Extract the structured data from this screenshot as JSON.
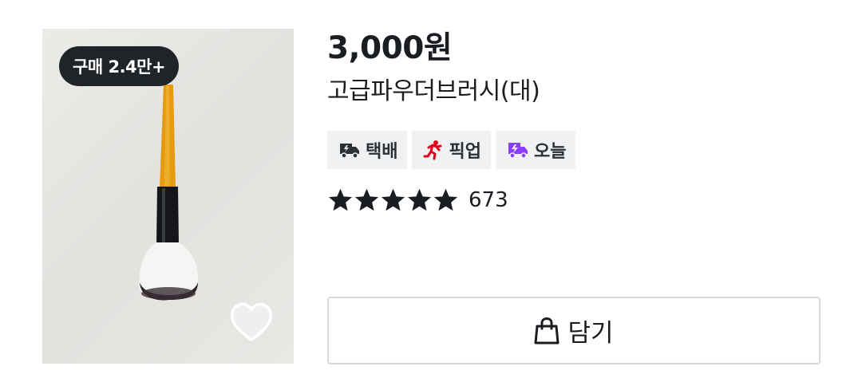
{
  "product": {
    "badge": "구매 2.4만+",
    "price": "3,000원",
    "name": "고급파우더브러시(대)",
    "tags": [
      {
        "label": "택배",
        "icon": "delivery-truck-icon",
        "icon_color": "#2c3137"
      },
      {
        "label": "픽업",
        "icon": "running-person-icon",
        "icon_color": "#e0001b"
      },
      {
        "label": "오늘",
        "icon": "fast-delivery-icon",
        "icon_color": "#8b3dff"
      }
    ],
    "rating_stars": 5,
    "review_count": "673",
    "cart_button_label": "담기"
  },
  "colors": {
    "badge_bg": "#1f2429",
    "tag_bg": "#f0f1f3",
    "pickup_red": "#e0001b",
    "today_purple": "#8b3dff",
    "star": "#1a1d21"
  }
}
